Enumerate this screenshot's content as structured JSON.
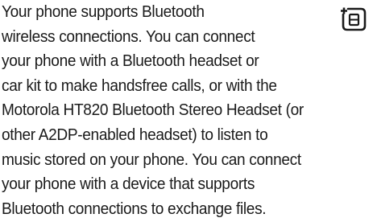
{
  "document": {
    "lines": [
      "Your phone supports Bluetooth",
      "wireless connections. You can connect",
      "your phone with a Bluetooth headset or",
      "car kit to make handsfree calls, or with the",
      "Motorola HT820 Bluetooth Stereo Headset (or",
      "other A2DP-enabled headset) to listen to",
      "music stored on your phone. You can connect",
      "your phone with a device that supports",
      "Bluetooth connections to exchange files."
    ],
    "icon": "feature-available-icon"
  }
}
